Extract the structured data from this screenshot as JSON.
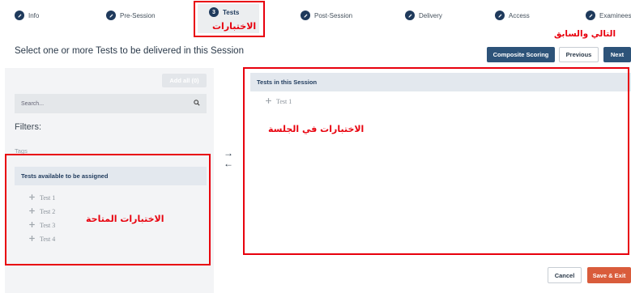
{
  "steps": [
    {
      "label": "Info",
      "icon": "pencil-icon"
    },
    {
      "label": "Pre-Session",
      "icon": "pencil-icon"
    },
    {
      "label": "Tests",
      "number": "3",
      "active": true
    },
    {
      "label": "Post-Session",
      "icon": "pencil-icon"
    },
    {
      "label": "Delivery",
      "icon": "pencil-icon"
    },
    {
      "label": "Access",
      "icon": "pencil-icon"
    },
    {
      "label": "Examinees",
      "icon": "pencil-icon"
    }
  ],
  "annotations": {
    "tests": "الاختبارات",
    "next_previous": "التالي والسابق",
    "tests_in_session": "الاختبارات في الجلسة",
    "available_tests": "الاختبارات المتاحة"
  },
  "page_title": "Select one or more Tests to be delivered in this Session",
  "buttons": {
    "composite_scoring": "Composite Scoring",
    "previous": "Previous",
    "next": "Next",
    "add_all": "Add all (0)",
    "cancel": "Cancel",
    "save_exit": "Save & Exit"
  },
  "search": {
    "placeholder": "Search..."
  },
  "filters_label": "Filters:",
  "tags_label": "Tags",
  "available_panel": {
    "title": "Tests available to be assigned",
    "items": [
      "Test 1",
      "Test 2",
      "Test 3",
      "Test 4"
    ]
  },
  "session_panel": {
    "title": "Tests in this Session",
    "items": [
      "Test 1"
    ]
  },
  "colors": {
    "primary": "#2d5379",
    "save": "#d95c3b",
    "annotation": "#e8000d",
    "step_icon": "#1f3a5c"
  }
}
